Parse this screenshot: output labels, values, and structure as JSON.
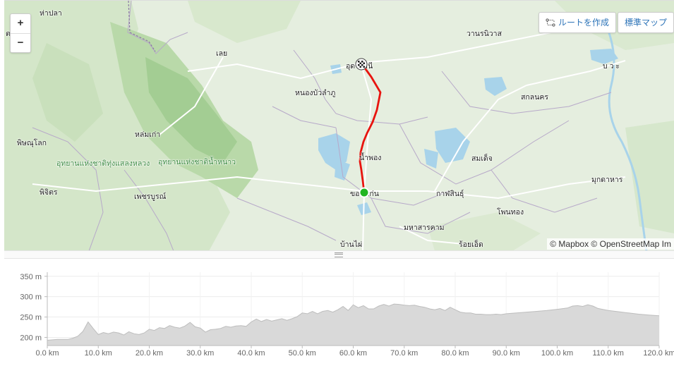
{
  "map": {
    "labels": [
      {
        "text": "ห่าปลา",
        "kind": "city"
      },
      {
        "text": "ตร",
        "kind": "city"
      },
      {
        "text": "วานรนิวาส",
        "kind": "city"
      },
      {
        "text": "เลย",
        "kind": "city"
      },
      {
        "text": "อุดรธานี",
        "kind": "city"
      },
      {
        "text": "บ ว ะ",
        "kind": "city"
      },
      {
        "text": "หนองบัวลำภู",
        "kind": "city"
      },
      {
        "text": "สกลนคร",
        "kind": "city"
      },
      {
        "text": "หล่มเก่า",
        "kind": "city"
      },
      {
        "text": "พิษณุโลก",
        "kind": "city"
      },
      {
        "text": "อุทยานแห่งชาติทุ่งแสลงหลวง",
        "kind": "park"
      },
      {
        "text": "อุทยานแห่งชาติน้ำหนาว",
        "kind": "park"
      },
      {
        "text": "น้ำพอง",
        "kind": "city"
      },
      {
        "text": "สมเด็จ",
        "kind": "city"
      },
      {
        "text": "มุกดาหาร",
        "kind": "city"
      },
      {
        "text": "พิจิตร",
        "kind": "city"
      },
      {
        "text": "เพชรบูรณ์",
        "kind": "city"
      },
      {
        "text": "ขอนแก่น",
        "kind": "city"
      },
      {
        "text": "กาฬสินธุ์",
        "kind": "city"
      },
      {
        "text": "โพนทอง",
        "kind": "city"
      },
      {
        "text": "มหาสารคาม",
        "kind": "city"
      },
      {
        "text": "ร้อยเอ็ด",
        "kind": "city"
      },
      {
        "text": "บ้านไผ่",
        "kind": "city"
      }
    ],
    "zoom_in": "+",
    "zoom_out": "−",
    "create_route_label": "ルートを作成",
    "standard_map_label": "標準マップ",
    "attribution": "© Mapbox © OpenStreetMap Im",
    "route_color": "#e8140f",
    "start_color": "#21b521",
    "start_marker_icon": "green-dot-start-marker",
    "finish_marker_icon": "checkered-flag-finish-marker"
  },
  "chart_data": {
    "type": "area",
    "x_unit": "km",
    "y_unit": "m",
    "xlim": [
      0,
      120
    ],
    "ylim": [
      180,
      360
    ],
    "x_ticks": [
      0,
      10,
      20,
      30,
      40,
      50,
      60,
      70,
      80,
      90,
      100,
      110,
      120
    ],
    "x_tick_labels": [
      "0.0 km",
      "10.0 km",
      "20.0 km",
      "30.0 km",
      "40.0 km",
      "50.0 km",
      "60.0 km",
      "70.0 km",
      "80.0 km",
      "90.0 km",
      "100.0 km",
      "110.0 km",
      "120.0 km"
    ],
    "y_ticks": [
      200,
      250,
      300,
      350
    ],
    "y_tick_labels": [
      "200 m",
      "250 m",
      "300 m",
      "350 m"
    ],
    "grid": true,
    "fill_color": "#d9d9d9",
    "line_color": "#bdbdbd",
    "x": [
      0,
      2,
      4,
      5,
      6,
      7,
      8,
      9,
      10,
      11,
      12,
      13,
      14,
      15,
      16,
      17,
      18,
      19,
      20,
      21,
      22,
      23,
      24,
      25,
      26,
      27,
      28,
      29,
      30,
      31,
      32,
      33,
      34,
      35,
      36,
      37,
      38,
      39,
      40,
      41,
      42,
      43,
      44,
      45,
      46,
      47,
      48,
      49,
      50,
      51,
      52,
      53,
      54,
      55,
      56,
      57,
      58,
      59,
      60,
      61,
      62,
      63,
      64,
      65,
      66,
      67,
      68,
      69,
      70,
      71,
      72,
      73,
      74,
      75,
      76,
      77,
      78,
      79,
      80,
      81,
      82,
      83,
      84,
      85,
      86,
      87,
      88,
      89,
      90,
      92,
      94,
      96,
      98,
      100,
      102,
      103,
      104,
      105,
      106,
      107,
      108,
      110,
      112,
      114,
      116,
      118,
      120
    ],
    "values": [
      193,
      195,
      195,
      198,
      203,
      215,
      238,
      222,
      207,
      212,
      209,
      213,
      211,
      206,
      214,
      209,
      207,
      211,
      220,
      217,
      224,
      222,
      229,
      225,
      223,
      228,
      237,
      226,
      223,
      213,
      219,
      220,
      222,
      227,
      225,
      228,
      229,
      227,
      238,
      245,
      239,
      244,
      240,
      243,
      246,
      242,
      246,
      251,
      260,
      258,
      264,
      258,
      264,
      266,
      262,
      268,
      276,
      266,
      280,
      273,
      278,
      270,
      270,
      277,
      281,
      277,
      282,
      281,
      279,
      278,
      279,
      276,
      274,
      270,
      268,
      271,
      266,
      274,
      268,
      262,
      260,
      260,
      257,
      257,
      256,
      256,
      257,
      256,
      258,
      260,
      262,
      264,
      266,
      269,
      272,
      277,
      278,
      276,
      280,
      277,
      271,
      266,
      263,
      260,
      257,
      255,
      253
    ]
  }
}
